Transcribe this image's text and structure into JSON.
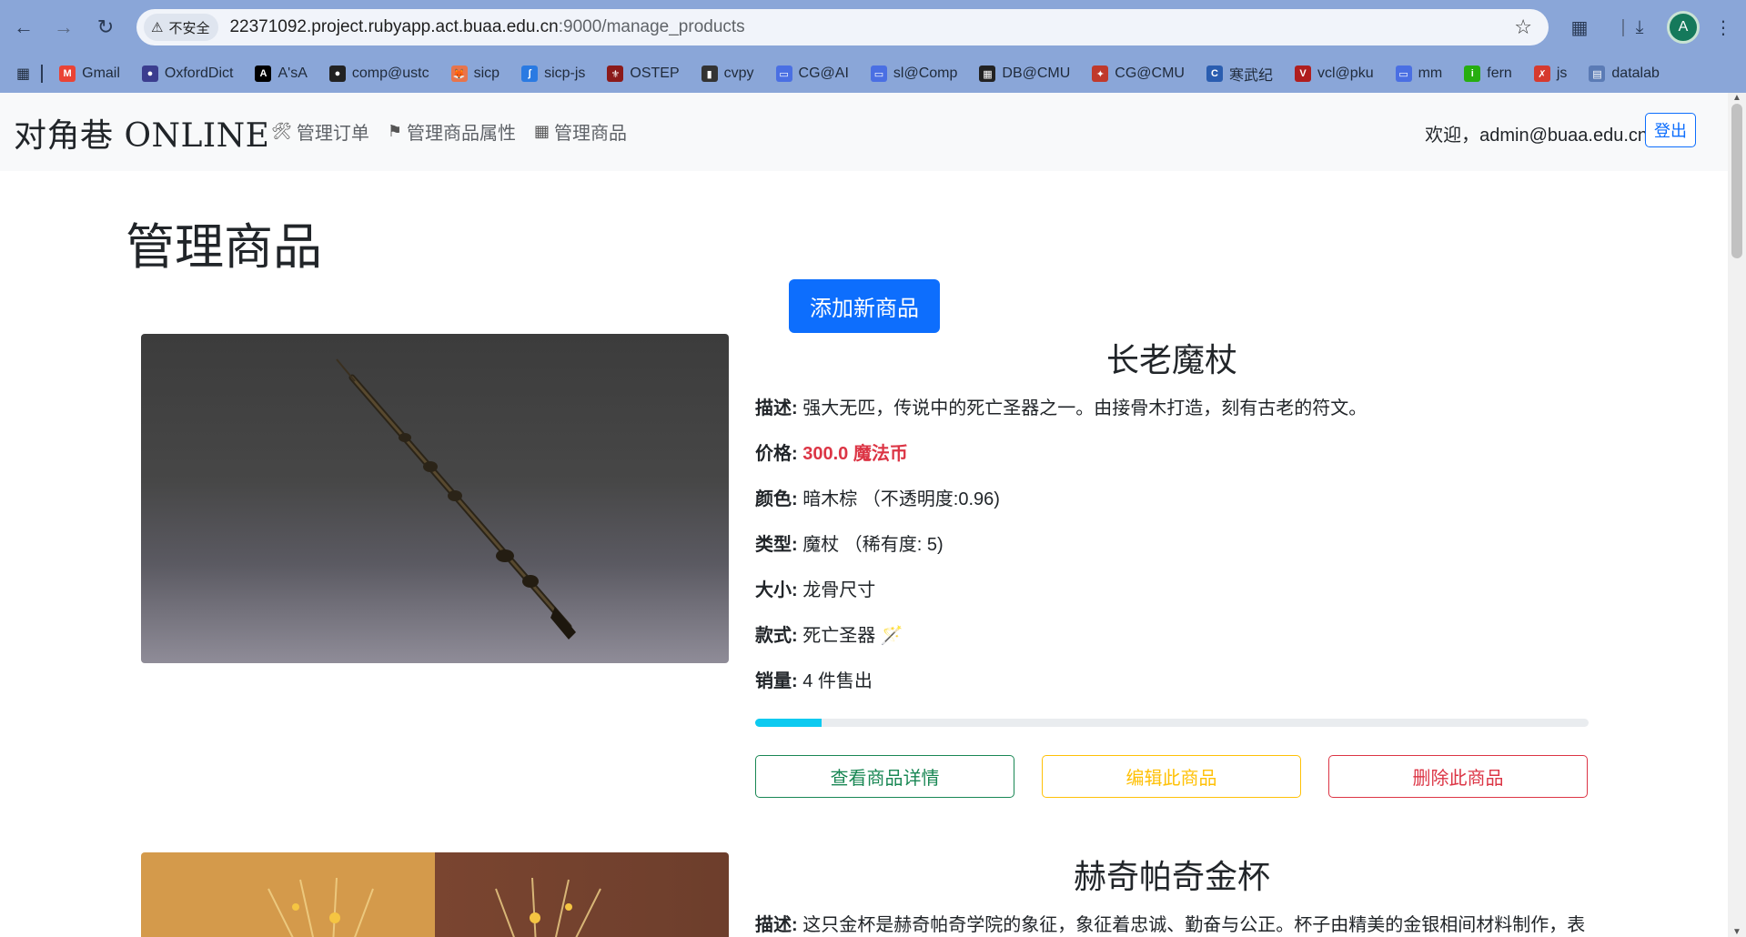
{
  "browser": {
    "security_label": "不安全",
    "url_host": "22371092.project.rubyapp.act.buaa.edu.cn",
    "url_path": ":9000/manage_products",
    "avatar_letter": "A",
    "bookmarks": [
      {
        "label": "Gmail",
        "color": "#ea4335",
        "glyph": "M"
      },
      {
        "label": "OxfordDict",
        "color": "#3b3d8f",
        "glyph": "●"
      },
      {
        "label": "A'sA",
        "color": "#000000",
        "glyph": "A"
      },
      {
        "label": "comp@ustc",
        "color": "#222222",
        "glyph": "●"
      },
      {
        "label": "sicp",
        "color": "#e8744b",
        "glyph": "🦊"
      },
      {
        "label": "sicp-js",
        "color": "#2a7ae2",
        "glyph": "ʃ"
      },
      {
        "label": "OSTEP",
        "color": "#8b1a1a",
        "glyph": "⚜"
      },
      {
        "label": "cvpy",
        "color": "#333333",
        "glyph": "▮"
      },
      {
        "label": "CG@AI",
        "color": "#4a6fe3",
        "glyph": "▭"
      },
      {
        "label": "sl@Comp",
        "color": "#4a6fe3",
        "glyph": "▭"
      },
      {
        "label": "DB@CMU",
        "color": "#222222",
        "glyph": "▦"
      },
      {
        "label": "CG@CMU",
        "color": "#c0392b",
        "glyph": "✦"
      },
      {
        "label": "寒武纪",
        "color": "#2a5db0",
        "glyph": "C"
      },
      {
        "label": "vcl@pku",
        "color": "#b01e1e",
        "glyph": "V"
      },
      {
        "label": "mm",
        "color": "#4a6fe3",
        "glyph": "▭"
      },
      {
        "label": "fern",
        "color": "#27ae10",
        "glyph": "i"
      },
      {
        "label": "js",
        "color": "#d63a2f",
        "glyph": "✗"
      },
      {
        "label": "datalab",
        "color": "#5b7bb5",
        "glyph": "▤"
      }
    ]
  },
  "navbar": {
    "brand": "对角巷 ONLINE",
    "links": [
      {
        "label": "管理订单",
        "icon": "tools-icon"
      },
      {
        "label": "管理商品属性",
        "icon": "tags-icon"
      },
      {
        "label": "管理商品",
        "icon": "sitemap-icon"
      }
    ],
    "welcome": "欢迎，admin@buaa.edu.cn",
    "logout": "登出"
  },
  "main": {
    "title": "管理商品",
    "add_button": "添加新商品"
  },
  "products": [
    {
      "name": "长老魔杖",
      "desc_label": "描述:",
      "desc": "强大无匹，传说中的死亡圣器之一。由接骨木打造，刻有古老的符文。",
      "price_label": "价格:",
      "price": "300.0 魔法币",
      "color_label": "颜色:",
      "color": "暗木棕 （不透明度:0.96)",
      "type_label": "类型:",
      "type": "魔杖 （稀有度: 5)",
      "size_label": "大小:",
      "size": "龙骨尺寸",
      "style_label": "款式:",
      "style": "死亡圣器 🪄",
      "sales_label": "销量:",
      "sales": "4 件售出",
      "sales_progress": 0.08,
      "view_button": "查看商品详情",
      "edit_button": "编辑此商品",
      "delete_button": "删除此商品"
    },
    {
      "name": "赫奇帕奇金杯",
      "desc_label": "描述:",
      "desc": "这只金杯是赫奇帕奇学院的象征，象征着忠诚、勤奋与公正。杯子由精美的金银相间材料制作，表"
    }
  ]
}
